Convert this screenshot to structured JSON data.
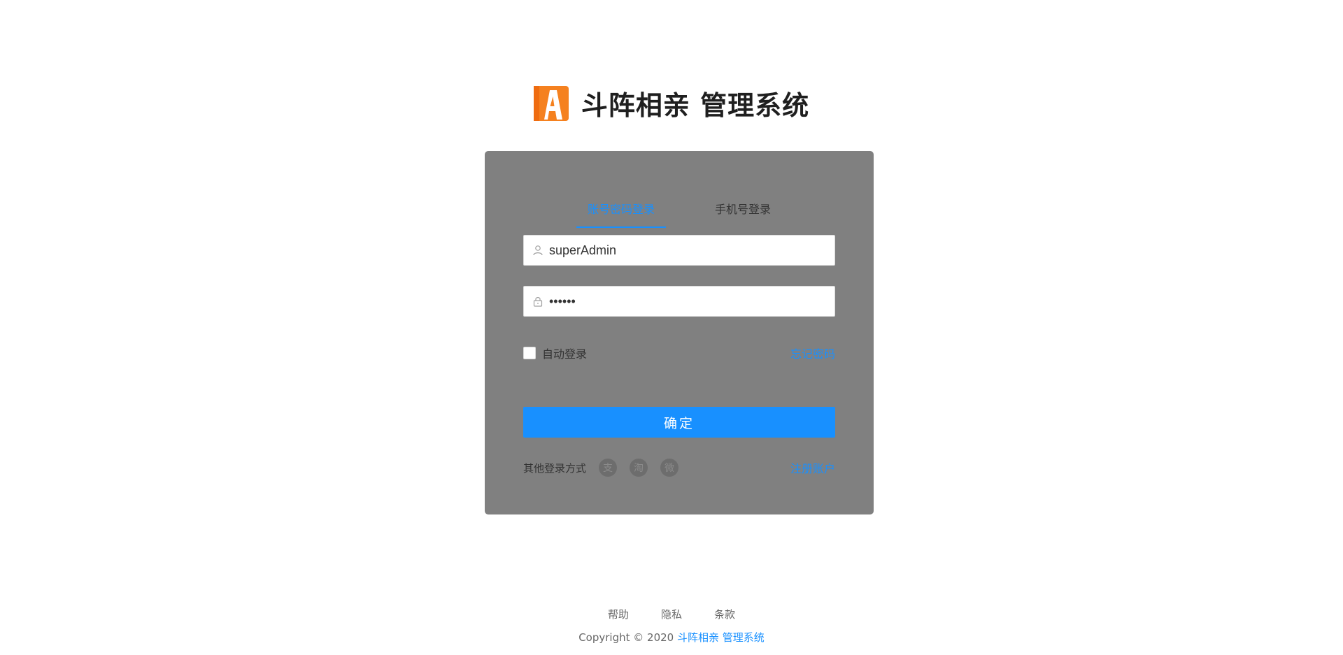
{
  "brand": {
    "title": "斗阵相亲 管理系统",
    "logo_colors": {
      "primary": "#f5811f",
      "letter": "#ffffff"
    },
    "logo_icon": "letter-a-logo"
  },
  "login": {
    "tabs": [
      {
        "label": "账号密码登录",
        "active": true
      },
      {
        "label": "手机号登录",
        "active": false
      }
    ],
    "username": {
      "value": "superAdmin",
      "icon": "user-icon"
    },
    "password": {
      "value": "••••••",
      "icon": "lock-icon"
    },
    "remember_label": "自动登录",
    "remember_checked": false,
    "forgot_label": "忘记密码",
    "submit_label": "确定",
    "other_login_label": "其他登录方式",
    "social_icons": [
      "alipay-icon",
      "taobao-icon",
      "weibo-icon"
    ],
    "social_glyphs": [
      "支",
      "淘",
      "微"
    ],
    "register_label": "注册账户"
  },
  "footer": {
    "links": [
      "帮助",
      "隐私",
      "条款"
    ],
    "copyright_prefix": "Copyright © 2020",
    "copyright_name": "斗阵相亲 管理系统"
  },
  "colors": {
    "accent": "#1890ff",
    "card_overlay": "#808080"
  }
}
